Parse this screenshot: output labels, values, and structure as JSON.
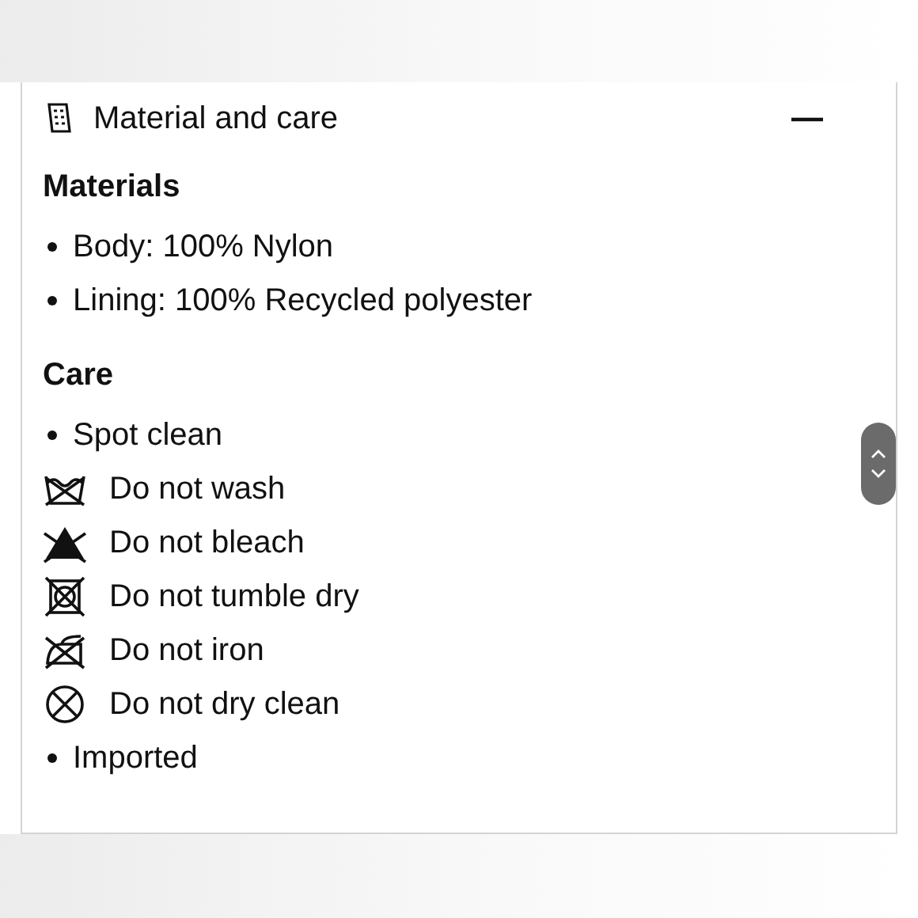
{
  "section": {
    "title": "Material and care",
    "expanded": true,
    "groups": [
      {
        "heading": "Materials",
        "items": [
          {
            "kind": "bullet",
            "text": "Body: 100% Nylon"
          },
          {
            "kind": "bullet",
            "text": "Lining: 100% Recycled polyester"
          }
        ]
      },
      {
        "heading": "Care",
        "items": [
          {
            "kind": "bullet",
            "text": "Spot clean"
          },
          {
            "kind": "wash",
            "text": "Do not wash"
          },
          {
            "kind": "bleach",
            "text": "Do not bleach"
          },
          {
            "kind": "tumble",
            "text": "Do not tumble dry"
          },
          {
            "kind": "iron",
            "text": "Do not iron"
          },
          {
            "kind": "dryclean",
            "text": "Do not dry clean"
          },
          {
            "kind": "bullet",
            "text": "Imported"
          }
        ]
      }
    ]
  }
}
